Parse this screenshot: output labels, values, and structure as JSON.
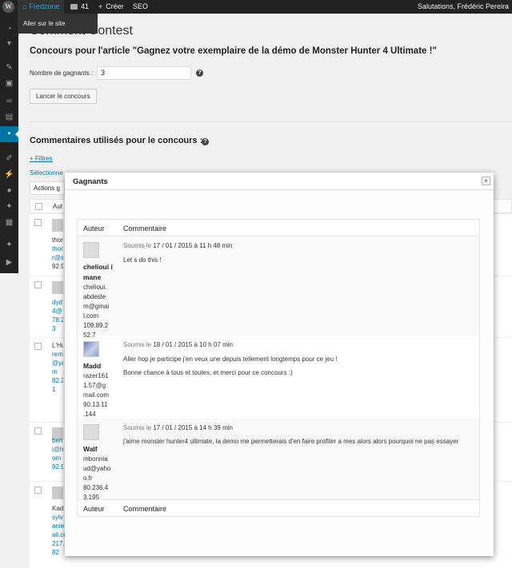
{
  "adminbar": {
    "logo": "wordpress-logo",
    "site_name": "Fredzone",
    "site_icon": "home-icon",
    "comments_count": "41",
    "new_label": "Créer",
    "seo_label": "SEO",
    "greeting": "Salutations, Frédéric Pereira",
    "dropdown_visit": "Aller sur le site"
  },
  "page": {
    "title": "Comment Contest",
    "subtitle": "Concours pour l'article \"Gagnez votre exemplaire de la démo de Monster Hunter 4 Ultimate !\"",
    "winners_label": "Nombre de gagnants :",
    "winners_value": "3",
    "launch_button": "Lancer le concours",
    "section_title": "Commentaires utilisés pour le concours :",
    "filters_link": "Filtres",
    "selected_text": "Sélectionnez",
    "actions_select": "Actions g",
    "column_author": "Aut"
  },
  "background_rows": [
    {
      "lines": [
        "thor",
        "thor",
        "r@s",
        "92.9"
      ]
    },
    {
      "lines": [
        "dyd",
        "4@",
        "78.2",
        "3"
      ]
    },
    {
      "lines": [
        "L'Hu",
        "rem",
        "@ya",
        "m",
        "82.2",
        "1"
      ]
    },
    {
      "lines": [
        "ben",
        "i@h",
        "om",
        "92.9"
      ]
    },
    {
      "lines": [
        "Kad",
        "sylv",
        "anie",
        "ail.com",
        "217.79.193.1",
        "82"
      ]
    }
  ],
  "modal": {
    "title": "Gagnants",
    "close": "×",
    "col_author": "Auteur",
    "col_comment": "Commentaire",
    "submitted_prefix": "Soumis le",
    "rows": [
      {
        "name": "chelioui imane",
        "details": [
          "chelioui.",
          "abdesle",
          "m@gmai",
          "l.com",
          "109.89.2",
          "52.7"
        ],
        "date": "17 / 01 / 2015 à 11 h 48 min",
        "message": [
          "Let s do this !"
        ]
      },
      {
        "name": "Madd",
        "details": [
          "razer161",
          "1.57@g",
          "mail.com",
          "90.13.11",
          ".144"
        ],
        "date": "18 / 01 / 2015 à 10 h 07 min",
        "message": [
          "Aller hop je participe j'en veux une depuis tellement longtemps pour ce jeu !",
          "Bonne chance à tous et toutes, et merci pour ce concours :)"
        ]
      },
      {
        "name": "Walf",
        "details": [
          "mbonnia",
          "ud@yaho",
          "o.fr",
          "80.236.4",
          "3.195"
        ],
        "date": "17 / 01 / 2015 à 14 h 39 min",
        "message": [
          "j'aime monster hunter4 ultimate, la demo me permetterais d'en faire profiter a mes alors alors pourquoi ne pas essayer"
        ]
      }
    ]
  }
}
